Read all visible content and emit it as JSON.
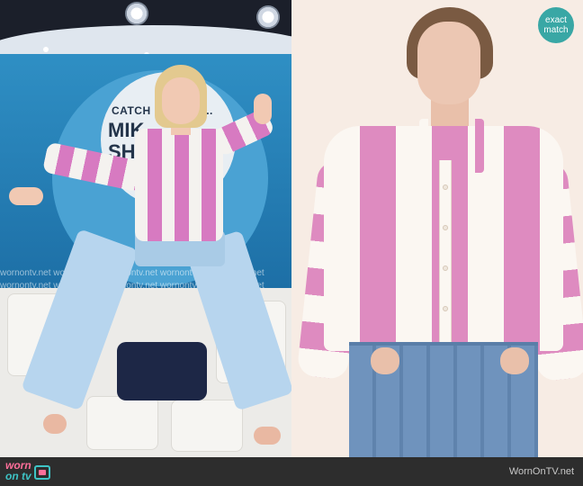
{
  "left_photo": {
    "sign_lines": [
      "CATCH UP WITH...",
      "MIK",
      "SH"
    ],
    "watermark_row1": "wornontv.net   wornontv.net   wornontv.net   wornontv.net   wornontv.net",
    "watermark_row2": "wornontv.net   wornontv.net   wornontv.net   wornontv.net   wornontv.net"
  },
  "right_photo": {
    "badge_line1": "exact",
    "badge_line2": "match"
  },
  "footer": {
    "logo_worn": "worn",
    "logo_on_tv": "on tv",
    "site_url": "WornOnTV.net"
  },
  "colors": {
    "stripe_pink": "#de8bc0",
    "badge_teal": "#39a7a5",
    "footer_bg": "#2d2d2d"
  }
}
